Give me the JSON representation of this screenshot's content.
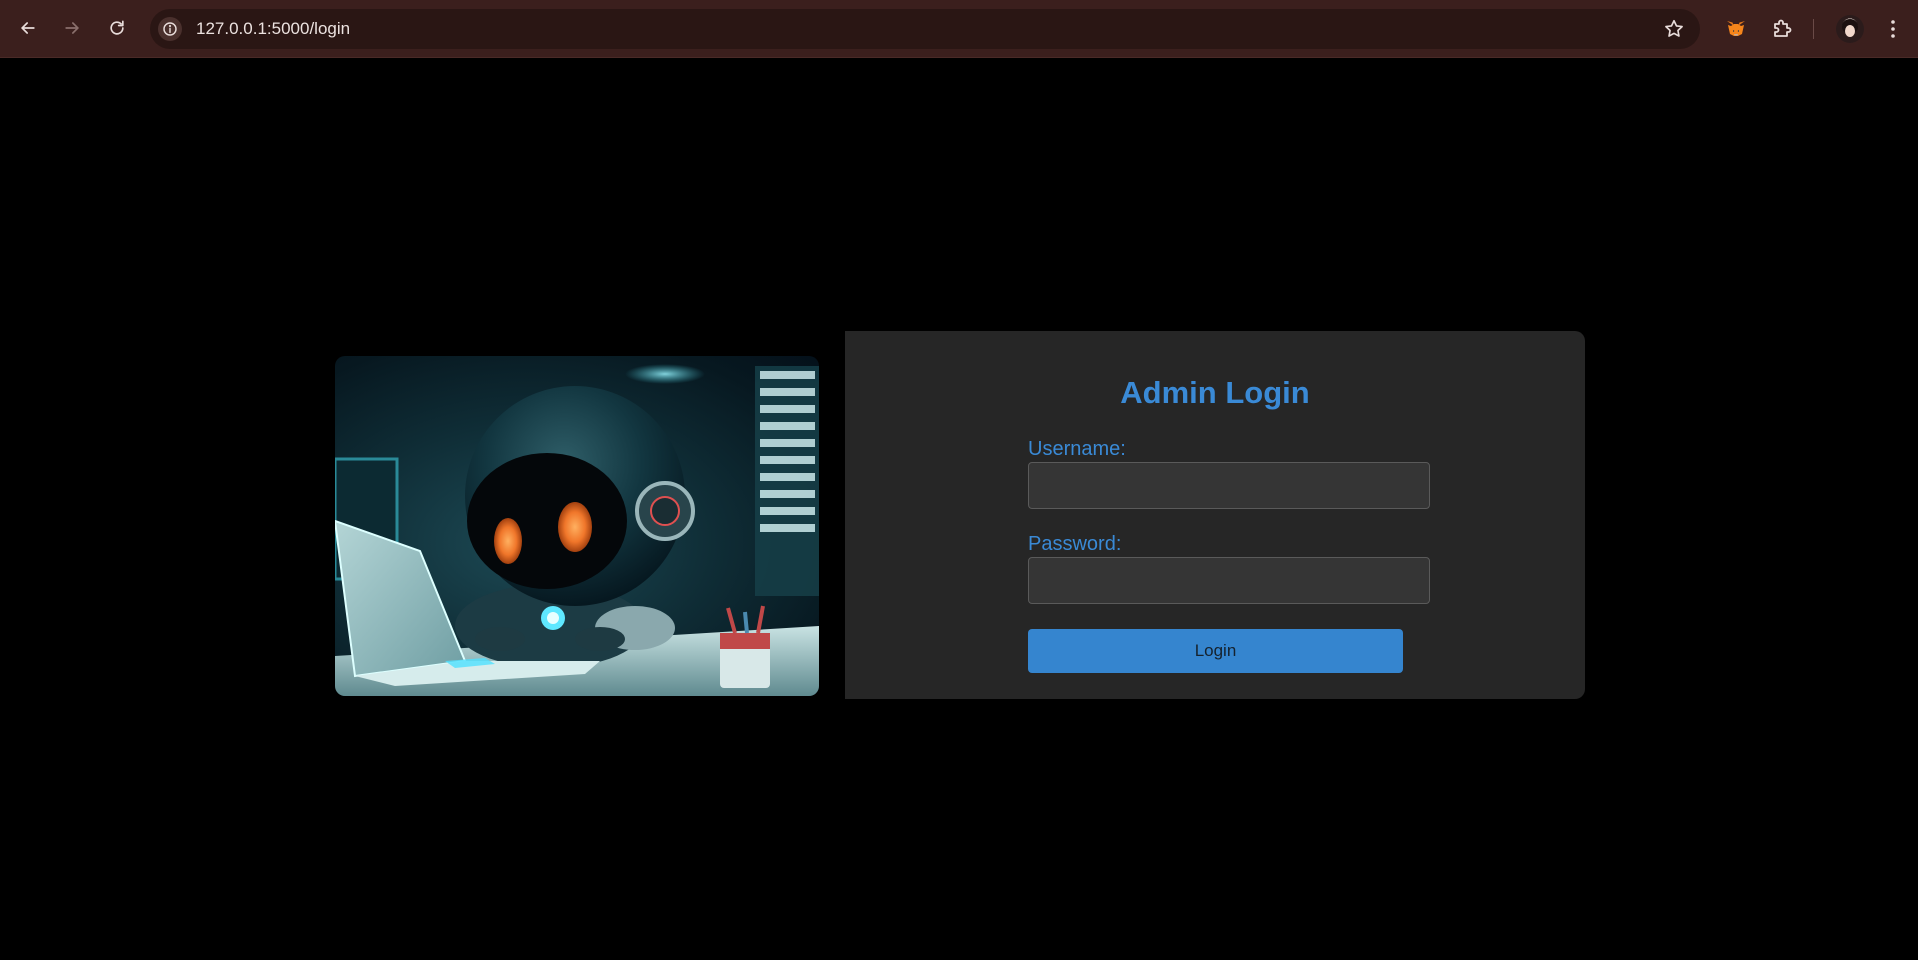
{
  "browser": {
    "url": "127.0.0.1:5000/login",
    "icons": {
      "back": "arrow-left-icon",
      "forward": "arrow-right-icon",
      "reload": "reload-icon",
      "site_info": "info-icon",
      "bookmark": "star-icon",
      "extension_fox": "metamask-fox-icon",
      "extensions": "puzzle-icon",
      "menu": "kebab-menu-icon"
    },
    "colors": {
      "chrome_bg": "#3b1f1d",
      "omnibox_bg": "#2a1614"
    }
  },
  "login": {
    "title": "Admin Login",
    "username_label": "Username:",
    "username_value": "",
    "password_label": "Password:",
    "password_value": "",
    "submit_label": "Login",
    "colors": {
      "accent": "#3a8ad6",
      "panel_bg": "#262626",
      "page_bg": "#000000"
    }
  },
  "hero_image": {
    "subject": "robot-at-laptop-illustration"
  }
}
